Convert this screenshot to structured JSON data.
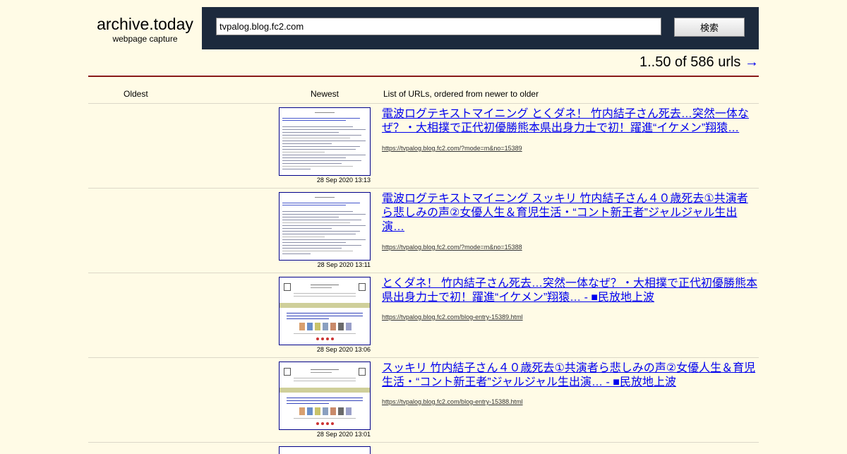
{
  "header": {
    "brand_title": "archive.today",
    "brand_subtitle": "webpage capture",
    "search_value": "tvpalog.blog.fc2.com",
    "search_button": "検索"
  },
  "pager": {
    "range_text": "1..50 of 586 urls",
    "next_arrow": "→"
  },
  "columns": {
    "oldest": "Oldest",
    "newest": "Newest",
    "list": "List of URLs, ordered from newer to older"
  },
  "entries": [
    {
      "title": "電波ログテキストマイニング とくダネ！ 竹内結子さん死去…突然一体なぜ？・大相撲で正代初優勝熊本県出身力士で初！躍進“イケメン”翔猿…",
      "url": "https://tvpalog.blog.fc2.com/?mode=m&no=15389",
      "timestamp": "28 Sep 2020 13:13",
      "thumb_style": "text"
    },
    {
      "title": "電波ログテキストマイニング スッキリ 竹内結子さん４０歳死去①共演者ら悲しみの声②女優人生＆育児生活・“コント新王者”ジャルジャル生出演…",
      "url": "https://tvpalog.blog.fc2.com/?mode=m&no=15388",
      "timestamp": "28 Sep 2020 13:11",
      "thumb_style": "text"
    },
    {
      "title": "とくダネ！ 竹内結子さん死去…突然一体なぜ？・大相撲で正代初優勝熊本県出身力士で初！躍進“イケメン”翔猿… - ■民放地上波",
      "url": "https://tvpalog.blog.fc2.com/blog-entry-15389.html",
      "timestamp": "28 Sep 2020 13:06",
      "thumb_style": "blog"
    },
    {
      "title": "スッキリ 竹内結子さん４０歳死去①共演者ら悲しみの声②女優人生＆育児生活・“コント新王者”ジャルジャル生出演… - ■民放地上波",
      "url": "https://tvpalog.blog.fc2.com/blog-entry-15388.html",
      "timestamp": "28 Sep 2020 13:01",
      "thumb_style": "blog"
    }
  ],
  "colors": {
    "background": "#fffbe6",
    "search_bar": "#1c2a3d",
    "link": "#0000ee",
    "rule": "#8a1a1a"
  }
}
